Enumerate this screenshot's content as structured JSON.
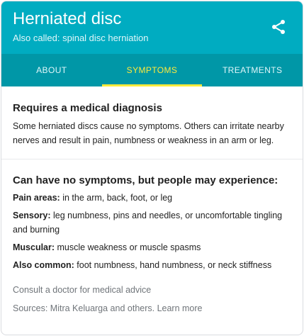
{
  "header": {
    "title": "Herniated disc",
    "subtitle": "Also called: spinal disc herniation",
    "share_icon": "share-icon",
    "color": "#00acc1"
  },
  "tabs": [
    {
      "label": "ABOUT",
      "active": false
    },
    {
      "label": "SYMPTOMS",
      "active": true
    },
    {
      "label": "TREATMENTS",
      "active": false
    }
  ],
  "diagnosis": {
    "heading": "Requires a medical diagnosis",
    "text": "Some herniated discs cause no symptoms. Others can irritate nearby nerves and result in pain, numbness or weakness in an arm or leg."
  },
  "symptoms": {
    "heading": "Can have no symptoms, but people may experience:",
    "items": [
      {
        "label": "Pain areas:",
        "text": " in the arm, back, foot, or leg"
      },
      {
        "label": "Sensory:",
        "text": " leg numbness, pins and needles, or uncomfortable tingling and burning"
      },
      {
        "label": "Muscular:",
        "text": " muscle weakness or muscle spasms"
      },
      {
        "label": "Also common:",
        "text": " foot numbness, hand numbness, or neck stiffness"
      }
    ]
  },
  "footer": {
    "consult": "Consult a doctor for medical advice",
    "sources_prefix": "Sources: Mitra Keluarga and others. ",
    "learn_more": "Learn more"
  },
  "colors": {
    "active_tab": "#ffeb3b",
    "tab_bar": "#0097a7"
  }
}
